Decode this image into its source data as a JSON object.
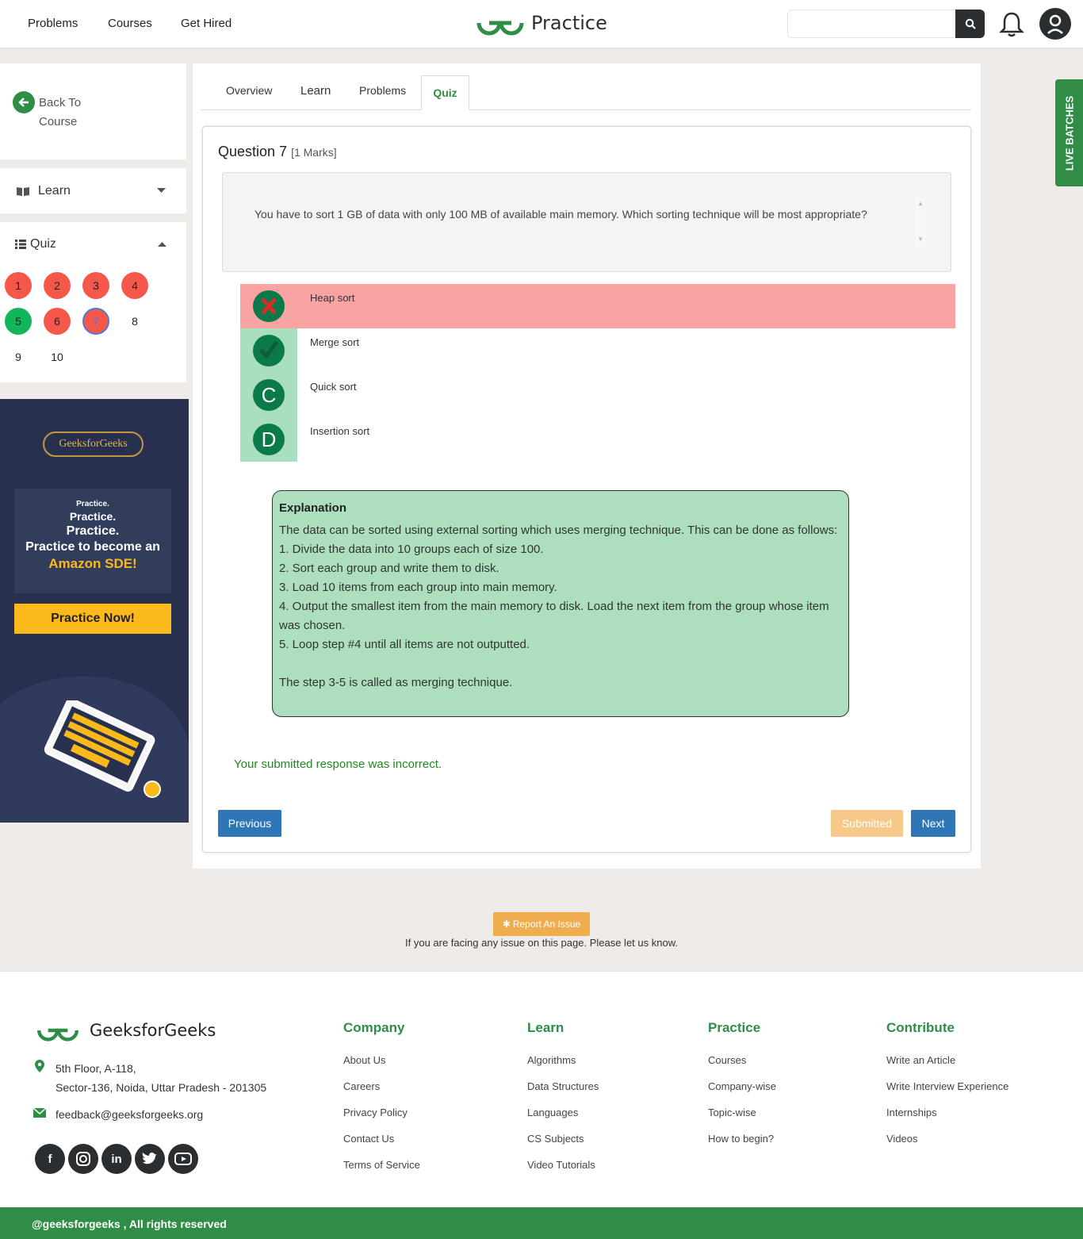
{
  "header": {
    "nav": [
      "Problems",
      "Courses",
      "Get Hired"
    ],
    "brand": "Practice",
    "search_placeholder": ""
  },
  "sidebar": {
    "back_label": "Back To Course",
    "learn_label": "Learn",
    "quiz_label": "Quiz",
    "questions": [
      {
        "n": "1",
        "status": "incorrect"
      },
      {
        "n": "2",
        "status": "incorrect"
      },
      {
        "n": "3",
        "status": "incorrect"
      },
      {
        "n": "4",
        "status": "incorrect"
      },
      {
        "n": "5",
        "status": "correct"
      },
      {
        "n": "6",
        "status": "incorrect"
      },
      {
        "n": "7",
        "status": "current"
      },
      {
        "n": "8",
        "status": "unanswered"
      },
      {
        "n": "9",
        "status": "unanswered"
      },
      {
        "n": "10",
        "status": "unanswered"
      }
    ]
  },
  "ad": {
    "pill": "GeeksforGeeks",
    "line1": "Practice.",
    "line2": "Practice.",
    "line3": "Practice.",
    "line4": "Practice to become an",
    "line5": "Amazon SDE!",
    "cta": "Practice Now!"
  },
  "tabs": [
    "Overview",
    "Learn",
    "Problems",
    "Quiz"
  ],
  "question": {
    "title": "Question 7",
    "marks": "[1 Marks]",
    "text": "You have to sort 1 GB of data with only 100 MB of available main memory. Which sorting technique will be most appropriate?",
    "options": [
      {
        "label": "Heap sort",
        "icon": "cross-icon",
        "state": "selected-wrong"
      },
      {
        "label": "Merge sort",
        "icon": "check-icon",
        "state": "correct"
      },
      {
        "label": "Quick sort",
        "icon": "C",
        "state": "neutral"
      },
      {
        "label": "Insertion sort",
        "icon": "D",
        "state": "neutral"
      }
    ],
    "explanation_title": "Explanation",
    "explanation_lines": [
      "The data can be sorted using external sorting which uses merging technique. This can be done as follows:",
      "1. Divide the data into 10 groups each of size 100.",
      "2. Sort each group and write them to disk.",
      "3. Load 10 items from each group into main memory.",
      "4. Output the smallest item from the main memory to disk. Load the next item from the group whose item was chosen.",
      "5. Loop step #4 until all items are not outputted.",
      "",
      "The step 3-5 is called as merging technique."
    ],
    "result": "Your submitted response was incorrect.",
    "prev_label": "Previous",
    "submitted_label": "Submitted",
    "next_label": "Next"
  },
  "live_batches": "LIVE BATCHES",
  "report": {
    "button": "Report An Issue",
    "note": "If you are facing any issue on this page. Please let us know."
  },
  "footer": {
    "brand": "GeeksforGeeks",
    "address1": "5th Floor, A-118,",
    "address2": "Sector-136, Noida, Uttar Pradesh - 201305",
    "email": "feedback@geeksforgeeks.org",
    "columns": [
      {
        "heading": "Company",
        "links": [
          "About Us",
          "Careers",
          "Privacy Policy",
          "Contact Us",
          "Terms of Service"
        ]
      },
      {
        "heading": "Learn",
        "links": [
          "Algorithms",
          "Data Structures",
          "Languages",
          "CS Subjects",
          "Video Tutorials"
        ]
      },
      {
        "heading": "Practice",
        "links": [
          "Courses",
          "Company-wise",
          "Topic-wise",
          "How to begin?"
        ]
      },
      {
        "heading": "Contribute",
        "links": [
          "Write an Article",
          "Write Interview Experience",
          "Internships",
          "Videos"
        ]
      }
    ],
    "social": [
      "facebook-icon",
      "instagram-icon",
      "linkedin-icon",
      "twitter-icon",
      "youtube-icon"
    ],
    "copyright": "@geeksforgeeks , All rights reserved"
  },
  "colors": {
    "brand_green": "#2f8d46",
    "wrong_bg": "#f9a3a3",
    "correct_strip": "#a9dfbf",
    "explanation_bg": "#addfbe",
    "primary_blue": "#2e76b6"
  }
}
